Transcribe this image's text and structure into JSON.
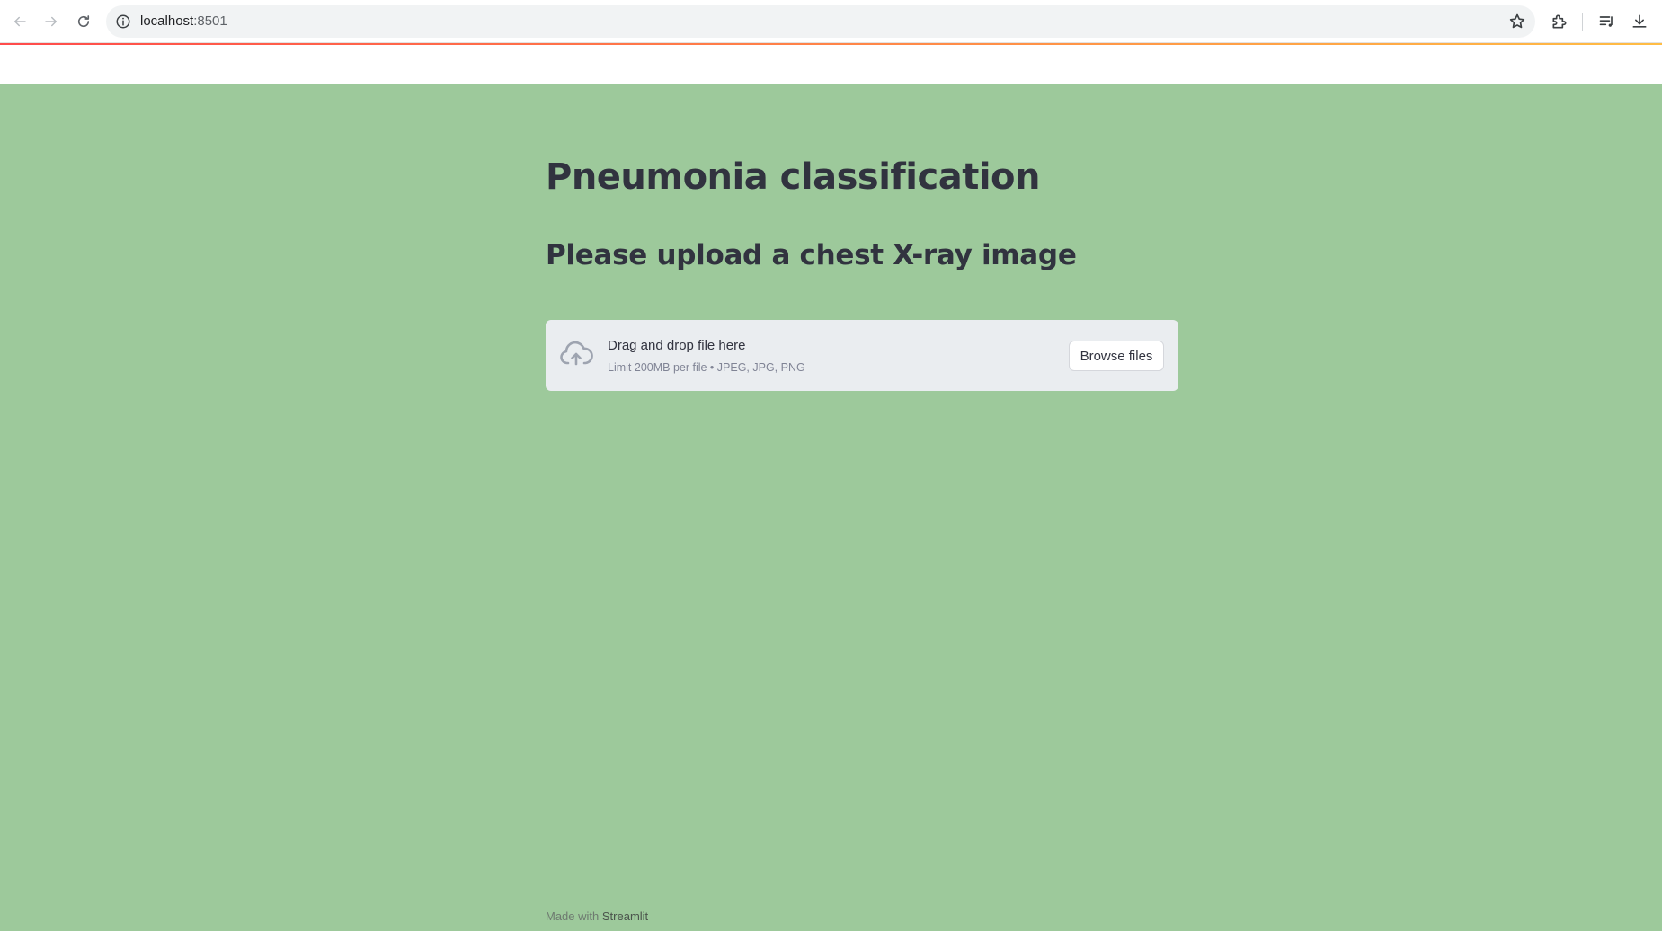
{
  "browser": {
    "url_host": "localhost",
    "url_port": ":8501",
    "icons": {
      "back": "arrow-left-icon",
      "forward": "arrow-right-icon",
      "reload": "reload-icon",
      "site_info": "info-icon",
      "bookmark": "star-icon",
      "extensions": "puzzle-icon",
      "media": "media-queue-icon",
      "downloads": "download-icon"
    }
  },
  "app": {
    "title": "Pneumonia classification",
    "subtitle": "Please upload a chest X-ray image",
    "background_color": "#9dc99b"
  },
  "uploader": {
    "drop_label": "Drag and drop file here",
    "limit_text": "Limit 200MB per file • JPEG, JPG, PNG",
    "browse_label": "Browse files",
    "icon": "cloud-upload-icon"
  },
  "footer": {
    "prefix": "Made with",
    "brand": "Streamlit"
  }
}
